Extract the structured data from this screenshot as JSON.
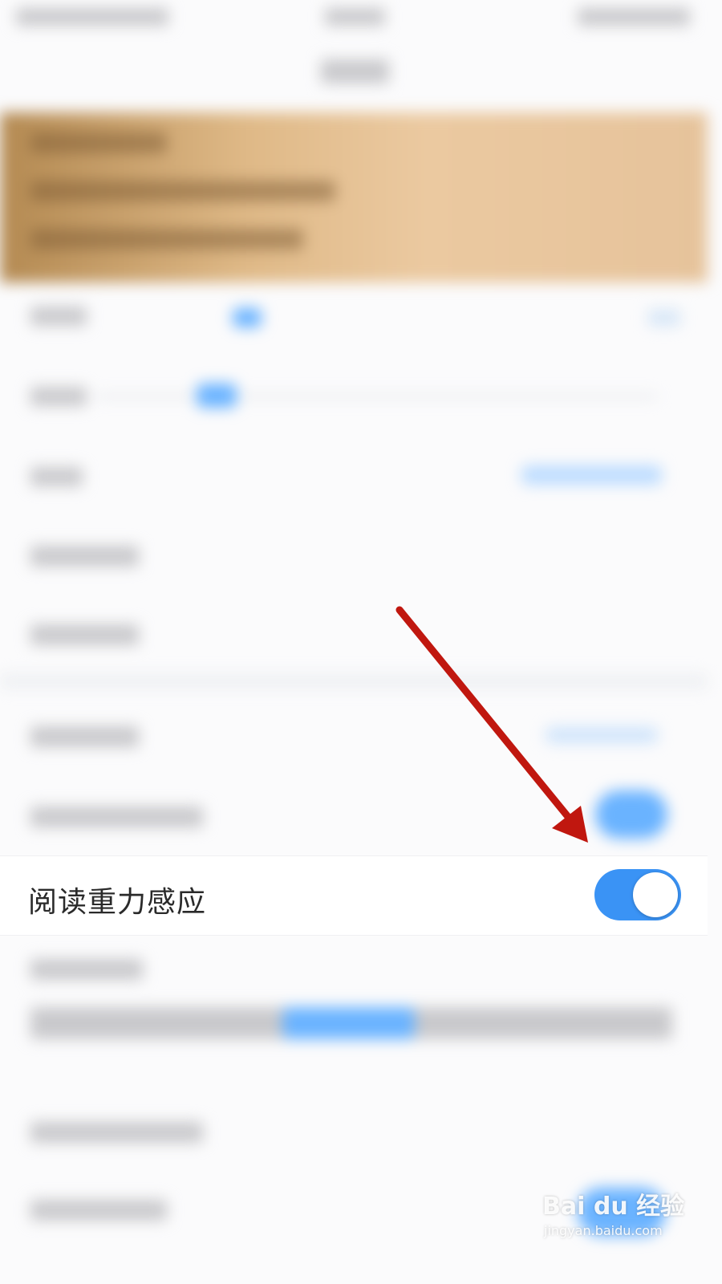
{
  "settings": {
    "gravity_sensing": {
      "label": "阅读重力感应",
      "enabled": true
    }
  },
  "colors": {
    "toggle_on": "#3a93f5",
    "arrow": "#c0170f",
    "banner_gold": "#dfb987"
  },
  "watermark": {
    "logo": "Bai du 经验",
    "url": "jingyan.baidu.com"
  }
}
